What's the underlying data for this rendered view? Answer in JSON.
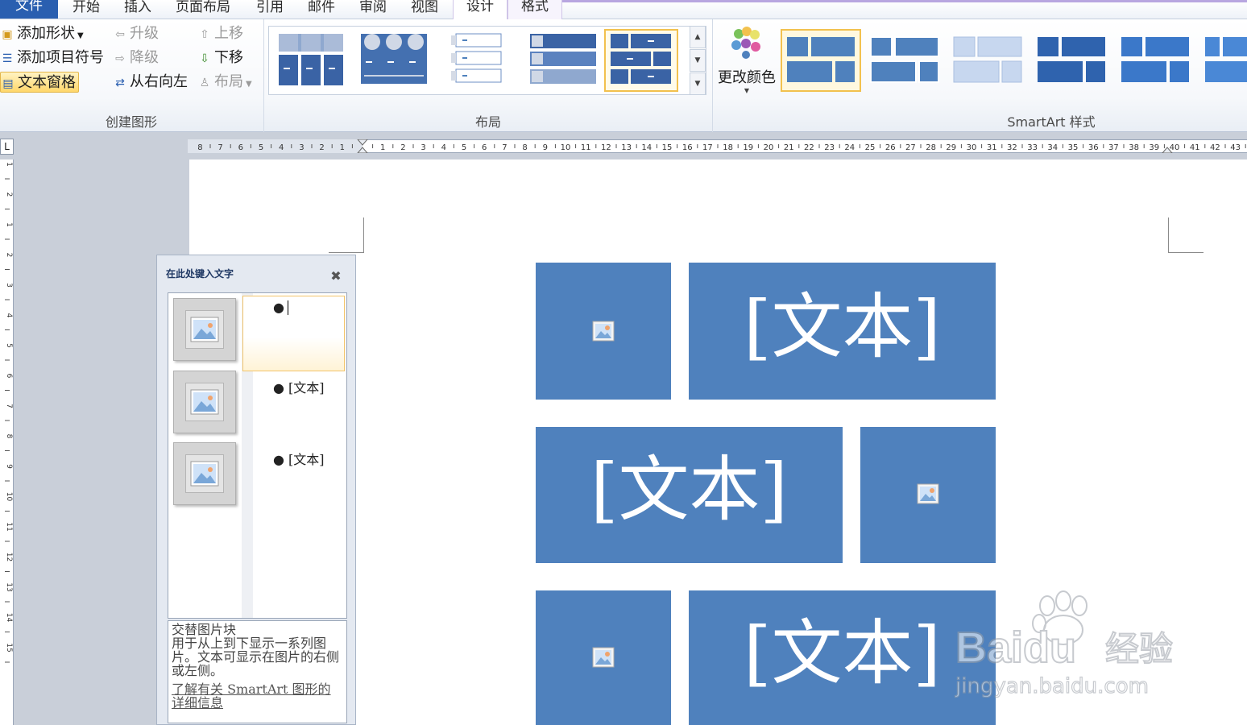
{
  "tabs": [
    {
      "label": "文件"
    },
    {
      "label": "开始"
    },
    {
      "label": "插入"
    },
    {
      "label": "页面布局"
    },
    {
      "label": "引用"
    },
    {
      "label": "邮件"
    },
    {
      "label": "审阅"
    },
    {
      "label": "视图"
    },
    {
      "label": "设计"
    },
    {
      "label": "格式"
    }
  ],
  "ribbon": {
    "create_group": {
      "label": "创建图形",
      "add_shape": "添加形状",
      "add_bullet": "添加项目符号",
      "text_pane": "文本窗格",
      "promote": "升级",
      "demote": "降级",
      "right_to_left": "从右向左",
      "move_up": "上移",
      "move_down": "下移",
      "layout": "布局"
    },
    "layout_group": {
      "label": "布局"
    },
    "styles_group": {
      "label": "SmartArt 样式",
      "change_colors": "更改颜色"
    }
  },
  "ruler": {
    "left_numbers": [
      "8",
      "7",
      "6",
      "5",
      "4",
      "3",
      "2",
      "1"
    ],
    "right_numbers": [
      "1",
      "2",
      "3",
      "4",
      "5",
      "6",
      "7",
      "8",
      "9",
      "10",
      "11",
      "12",
      "13",
      "14",
      "15",
      "16",
      "17",
      "18",
      "19",
      "20",
      "21",
      "22",
      "23",
      "24",
      "25",
      "26",
      "27",
      "28",
      "29",
      "30",
      "31",
      "32",
      "33",
      "34",
      "35",
      "36",
      "37",
      "38",
      "39",
      "40",
      "41",
      "42",
      "43"
    ],
    "vertical_numbers": [
      "1",
      "2",
      "1",
      "2",
      "3",
      "4",
      "5",
      "6",
      "7",
      "8",
      "9",
      "10",
      "11",
      "12",
      "13",
      "14",
      "15"
    ],
    "corner": "L"
  },
  "text_pane": {
    "title": "在此处键入文字",
    "items": [
      "",
      "[文本]",
      "[文本]"
    ],
    "description_title": "交替图片块",
    "description": "用于从上到下显示一系列图片。文本可显示在图片的右侧或左侧。",
    "learn_more": "了解有关 SmartArt 图形的详细信息"
  },
  "smartart": {
    "blocks": [
      "[文本]",
      "[文本]",
      "[文本]"
    ]
  },
  "colors": {
    "accent": "#4f81bd",
    "file_tab": "#2a5fb0",
    "selection": "#f2c14e"
  },
  "watermark": {
    "brand": "Baidu",
    "cn": "经验",
    "url": "jingyan.baidu.com"
  }
}
